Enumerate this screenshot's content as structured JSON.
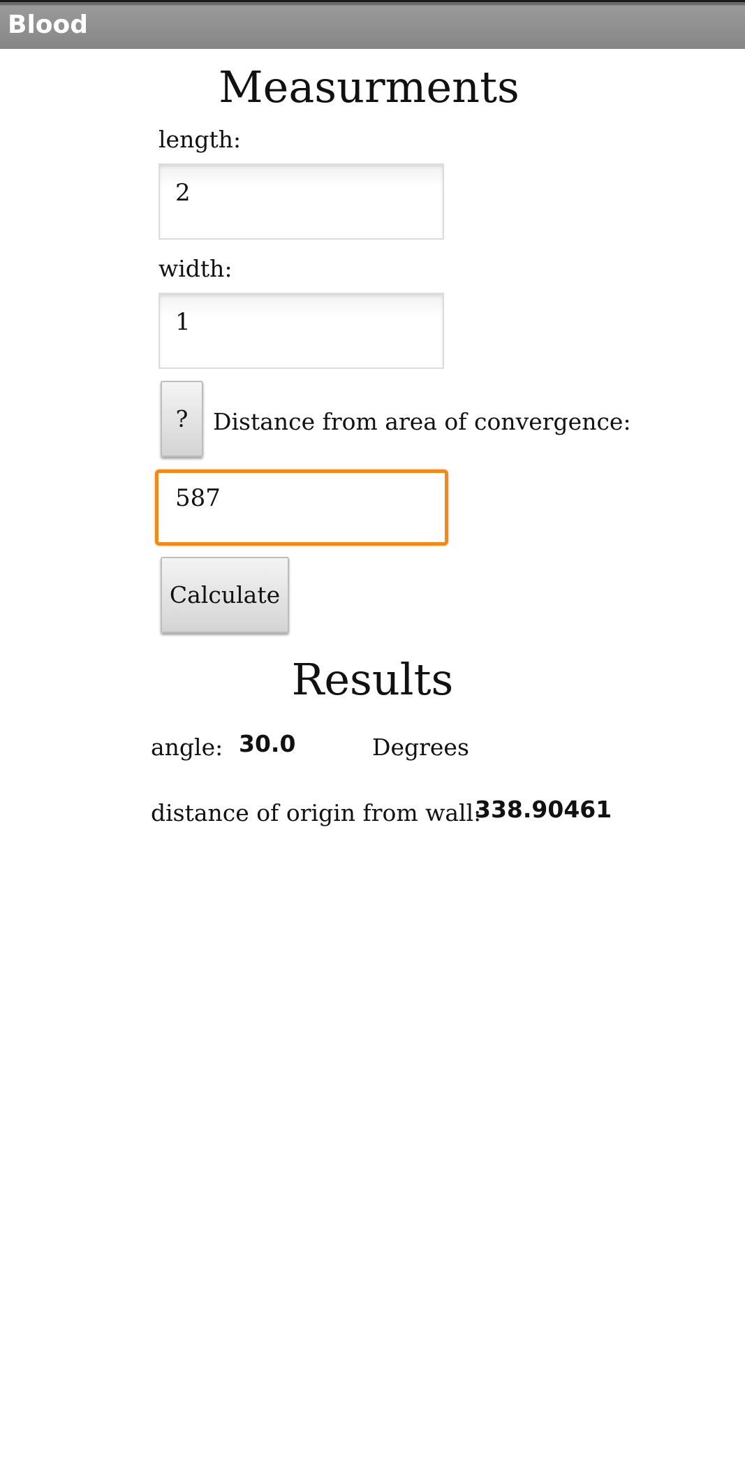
{
  "app": {
    "title": "Blood"
  },
  "measurements": {
    "heading": "Measurments",
    "length_label": "length:",
    "length_value": "2",
    "width_label": "width:",
    "width_value": "1",
    "help_button_label": "?",
    "distance_label": "Distance from area of convergence:",
    "distance_value": "587",
    "calculate_label": "Calculate"
  },
  "results": {
    "heading": "Results",
    "angle_label": "angle:",
    "angle_value": "30.0",
    "angle_unit": "Degrees",
    "distance_label": "distance of origin from wall:",
    "distance_value": "338.90461"
  },
  "colors": {
    "titlebar": "#858585",
    "focus_border": "#f08a1c"
  }
}
